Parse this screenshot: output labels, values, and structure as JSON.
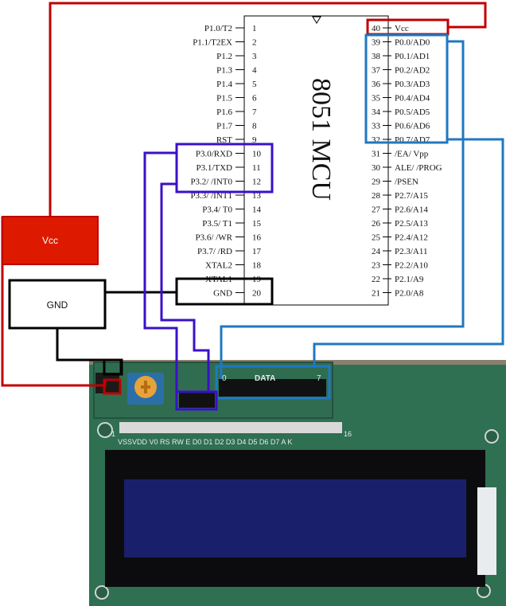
{
  "mcu": {
    "title": "8051 MCU",
    "left_pins": [
      {
        "num": "1",
        "label": "P1.0/T2"
      },
      {
        "num": "2",
        "label": "P1.1/T2EX"
      },
      {
        "num": "3",
        "label": "P1.2"
      },
      {
        "num": "4",
        "label": "P1.3"
      },
      {
        "num": "5",
        "label": "P1.4"
      },
      {
        "num": "6",
        "label": "P1.5"
      },
      {
        "num": "7",
        "label": "P1.6"
      },
      {
        "num": "8",
        "label": "P1.7"
      },
      {
        "num": "9",
        "label": "RST"
      },
      {
        "num": "10",
        "label": "P3.0/RXD"
      },
      {
        "num": "11",
        "label": "P3.1/TXD"
      },
      {
        "num": "12",
        "label": "P3.2/ /INT0"
      },
      {
        "num": "13",
        "label": "P3.3/ /INT1"
      },
      {
        "num": "14",
        "label": "P3.4/ T0"
      },
      {
        "num": "15",
        "label": "P3.5/ T1"
      },
      {
        "num": "16",
        "label": "P3.6/ /WR"
      },
      {
        "num": "17",
        "label": "P3.7/ /RD"
      },
      {
        "num": "18",
        "label": "XTAL2"
      },
      {
        "num": "19",
        "label": "XTAL1"
      },
      {
        "num": "20",
        "label": "GND"
      }
    ],
    "right_pins": [
      {
        "num": "40",
        "label": "Vcc"
      },
      {
        "num": "39",
        "label": "P0.0/AD0"
      },
      {
        "num": "38",
        "label": "P0.1/AD1"
      },
      {
        "num": "37",
        "label": "P0.2/AD2"
      },
      {
        "num": "36",
        "label": "P0.3/AD3"
      },
      {
        "num": "35",
        "label": "P0.4/AD4"
      },
      {
        "num": "34",
        "label": "P0.5/AD5"
      },
      {
        "num": "33",
        "label": "P0.6/AD6"
      },
      {
        "num": "32",
        "label": "P0.7/AD7"
      },
      {
        "num": "31",
        "label": "/EA/ Vpp"
      },
      {
        "num": "30",
        "label": "ALE/ /PROG"
      },
      {
        "num": "29",
        "label": "/PSEN"
      },
      {
        "num": "28",
        "label": "P2.7/A15"
      },
      {
        "num": "27",
        "label": "P2.6/A14"
      },
      {
        "num": "26",
        "label": "P2.5/A13"
      },
      {
        "num": "25",
        "label": "P2.4/A12"
      },
      {
        "num": "24",
        "label": "P2.3/A11"
      },
      {
        "num": "23",
        "label": "P2.2/A10"
      },
      {
        "num": "22",
        "label": "P2.1/A9"
      },
      {
        "num": "21",
        "label": "P2.0/A8"
      }
    ]
  },
  "power": {
    "vcc_label": "Vcc",
    "gnd_label": "GND"
  },
  "lcd": {
    "pin_first": "1",
    "pin_last": "16",
    "pin_names": "VSSVDD V0 RS RW E D0 D1 D2 D3 D4 D5 D6 D7 A K",
    "header_data_label": "DATA",
    "header_left_mark": "0",
    "header_right_mark": "7"
  },
  "colors": {
    "vcc_wire": "#c00000",
    "gnd_wire": "#000000",
    "data_wire": "#1f78c1",
    "control_wire": "#3a10c8",
    "pcb": "#2f6f52",
    "lcd_glass": "#1a1f6b"
  }
}
